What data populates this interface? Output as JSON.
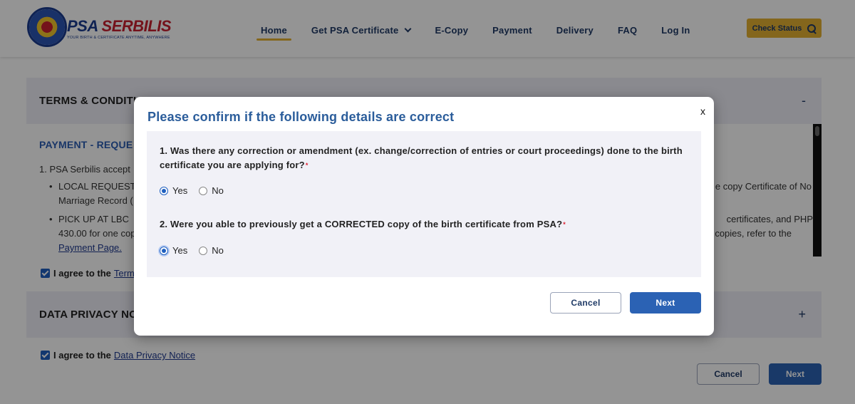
{
  "header": {
    "logo": {
      "brand_prefix": "PSA",
      "brand_suffix": "SERBILIS",
      "tagline": "YOUR BIRTH & CERTIFICATE ANYTIME, ANYWHERE"
    },
    "nav": [
      {
        "label": "Home",
        "active": true
      },
      {
        "label": "Get PSA Certificate",
        "has_dropdown": true
      },
      {
        "label": "E-Copy"
      },
      {
        "label": "Payment"
      },
      {
        "label": "Delivery"
      },
      {
        "label": "FAQ"
      },
      {
        "label": "Log In"
      }
    ],
    "check_status_label": "Check Status"
  },
  "background": {
    "terms_title": "TERMS & CONDITIO",
    "terms_toggle": "-",
    "payment_heading": "PAYMENT - REQUE",
    "line1": "1. PSA Serbilis accept",
    "bullet1_line1": "LOCAL REQUEST",
    "bullet1_line2": "Marriage Record (",
    "bullet2_line1": "PICK UP AT LBC",
    "bullet2_line2": "430.00 for one cop",
    "payment_page_link": "Payment Page.",
    "right1": "e copy Certificate of No",
    "right2": "certificates, and PHP",
    "right3": "copies, refer to the",
    "agree_terms_prefix": "I agree to the",
    "agree_terms_link": "Term",
    "privacy_title": "DATA PRIVACY NOT",
    "privacy_toggle": "+",
    "agree_privacy_prefix": "I agree to the",
    "agree_privacy_link": "Data Privacy Notice",
    "cancel_label": "Cancel",
    "next_label": "Next"
  },
  "modal": {
    "title": "Please confirm if the following details are correct",
    "close_label": "x",
    "question1": "1. Was there any correction or amendment (ex. change/correction of entries or court proceedings) done to the birth certificate you are applying for?",
    "question2": "2. Were you able to previously get a CORRECTED copy of the birth certificate from PSA?",
    "required_mark": "*",
    "yes_label": "Yes",
    "no_label": "No",
    "q1_selected": "Yes",
    "q2_selected": "Yes",
    "cancel_label": "Cancel",
    "next_label": "Next"
  },
  "colors": {
    "accent": "#e3b031",
    "primary": "#2b62b4",
    "title_blue": "#2b5d9b",
    "nav_text": "#1f3a66",
    "required": "#dd2233"
  },
  "icons": [
    "seal-logo-icon",
    "chevron-down-icon",
    "search-icon",
    "close-icon",
    "checkbox-checked-icon",
    "radio-icon"
  ]
}
